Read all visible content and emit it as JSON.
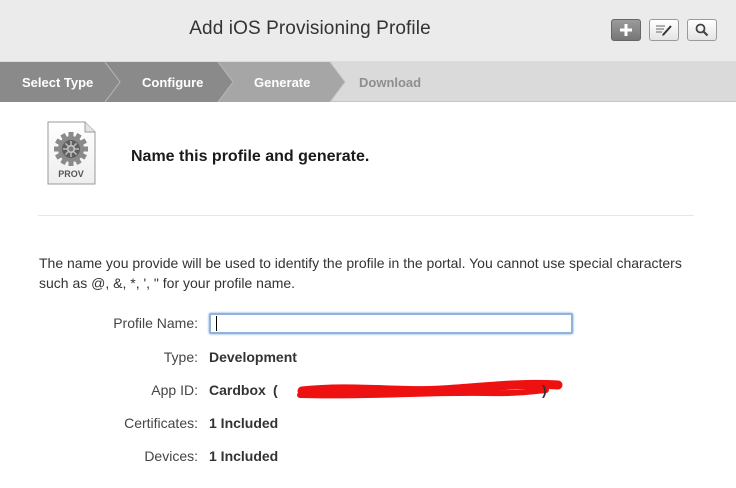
{
  "header": {
    "title": "Add iOS Provisioning Profile",
    "buttons": [
      {
        "name": "add-button",
        "icon": "plus-icon"
      },
      {
        "name": "edit-button",
        "icon": "edit-icon"
      },
      {
        "name": "search-button",
        "icon": "search-icon"
      }
    ]
  },
  "steps": [
    {
      "label": "Select Type",
      "state": "done"
    },
    {
      "label": "Configure",
      "state": "done"
    },
    {
      "label": "Generate",
      "state": "current"
    },
    {
      "label": "Download",
      "state": "todo"
    }
  ],
  "main": {
    "icon_label": "PROV",
    "heading": "Name this profile and generate.",
    "description": "The name you provide will be used to identify the profile in the portal. You cannot use special characters such as @, &, *, ', \" for your profile name.",
    "fields": {
      "profile_name": {
        "label": "Profile Name:",
        "value": "",
        "placeholder": ""
      },
      "type": {
        "label": "Type:",
        "value": "Development"
      },
      "app_id": {
        "label": "App ID:",
        "value_head": "Cardbox",
        "paren_open": "(",
        "value_tail": ")"
      },
      "certificates": {
        "label": "Certificates:",
        "value": "1 Included"
      },
      "devices": {
        "label": "Devices:",
        "value": "1 Included"
      }
    }
  },
  "colors": {
    "header_bg": "#ebebeb",
    "step_done": "#8a8a8a",
    "step_current": "#a6a6a6",
    "step_todo": "#dadada",
    "redaction": "#ee1111"
  }
}
